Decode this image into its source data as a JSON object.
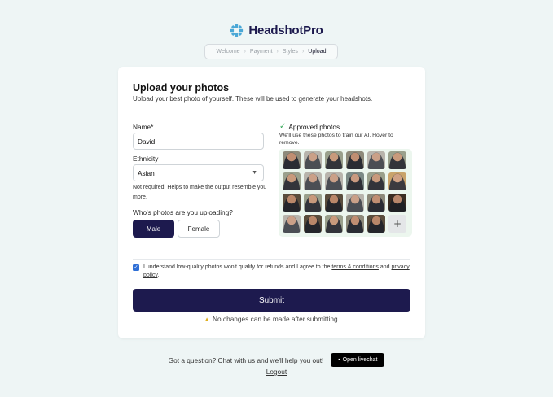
{
  "brand": {
    "name": "HeadshotPro",
    "accent": "#1d1a4e",
    "logo_color": "#4aa7d6"
  },
  "breadcrumb": {
    "items": [
      "Welcome",
      "Payment",
      "Styles",
      "Upload"
    ],
    "active": "Upload"
  },
  "card": {
    "title": "Upload your photos",
    "subtitle": "Upload your best photo of yourself. These will be used to generate your headshots."
  },
  "form": {
    "name_label": "Name*",
    "name_value": "David",
    "ethnicity_label": "Ethnicity",
    "ethnicity_value": "Asian",
    "ethnicity_hint": "Not required. Helps to make the output resemble you more.",
    "gender_question": "Who's photos are you uploading?",
    "gender_options": [
      "Male",
      "Female"
    ],
    "gender_selected": "Male"
  },
  "approved": {
    "title": "Approved photos",
    "description": "We'll use these photos to train our AI. Hover to remove.",
    "photo_count": 23,
    "add_icon": "plus-icon"
  },
  "consent": {
    "checked": true,
    "text_before": "I understand low-quality photos won't qualify for refunds and I agree to the",
    "terms_link": "terms & conditions",
    "and": "and",
    "privacy_link": "privacy policy",
    "text_after": "."
  },
  "submit": {
    "label": "Submit",
    "warning": "No changes can be made after submitting."
  },
  "footer": {
    "question": "Got a question? Chat with us and we'll help you out!",
    "livechat_label": "Open livechat",
    "logout_label": "Logout"
  }
}
